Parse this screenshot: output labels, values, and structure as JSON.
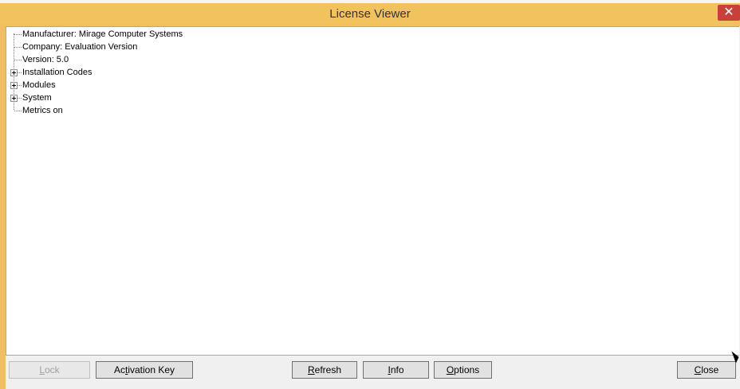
{
  "window": {
    "title": "License Viewer",
    "close_glyph": "✕"
  },
  "tree": {
    "nodes": [
      {
        "label": "Manufacturer: Mirage Computer Systems",
        "expandable": false
      },
      {
        "label": "Company: Evaluation Version",
        "expandable": false
      },
      {
        "label": "Version: 5.0",
        "expandable": false
      },
      {
        "label": "Installation Codes",
        "expandable": true
      },
      {
        "label": "Modules",
        "expandable": true
      },
      {
        "label": "System",
        "expandable": true
      },
      {
        "label": "Metrics on",
        "expandable": false
      }
    ]
  },
  "buttons": {
    "lock": {
      "pre": "",
      "ul": "L",
      "post": "ock",
      "enabled": false
    },
    "activation_key": {
      "pre": "Ac",
      "ul": "t",
      "post": "ivation Key"
    },
    "refresh": {
      "pre": "",
      "ul": "R",
      "post": "efresh"
    },
    "info": {
      "pre": "",
      "ul": "I",
      "post": "nfo"
    },
    "options": {
      "pre": "",
      "ul": "O",
      "post": "ptions"
    },
    "close": {
      "pre": "",
      "ul": "C",
      "post": "lose"
    }
  },
  "icons": {
    "expand": "plus-box-icon",
    "close": "close-icon"
  },
  "colors": {
    "titlebar": "#f1c35f",
    "close_button": "#c8403a"
  }
}
